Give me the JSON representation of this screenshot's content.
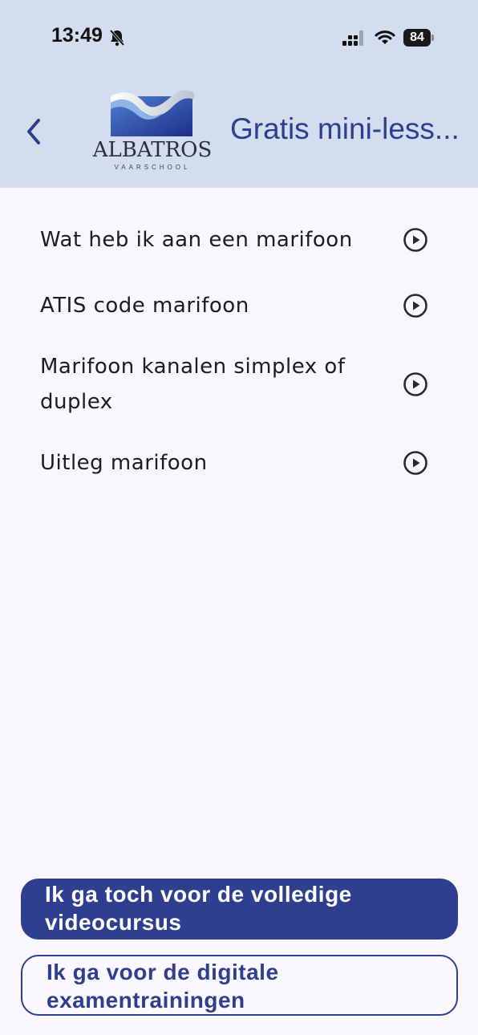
{
  "status_bar": {
    "time": "13:49",
    "battery": "84"
  },
  "header": {
    "title": "Gratis mini-less...",
    "logo": {
      "name": "ALBATROS",
      "subtitle": "VAARSCHOOL"
    }
  },
  "lessons": [
    {
      "label": "Wat heb ik aan een marifoon"
    },
    {
      "label": "ATIS code marifoon"
    },
    {
      "label": "Marifoon kanalen simplex of duplex"
    },
    {
      "label": "Uitleg marifoon"
    }
  ],
  "buttons": {
    "primary": "Ik ga toch voor de volledige videocursus",
    "secondary": "Ik ga voor de digitale examentrainingen"
  },
  "colors": {
    "header_bg": "#d2deef",
    "accent": "#2e3f8f",
    "page_bg": "#f9f6fd"
  }
}
